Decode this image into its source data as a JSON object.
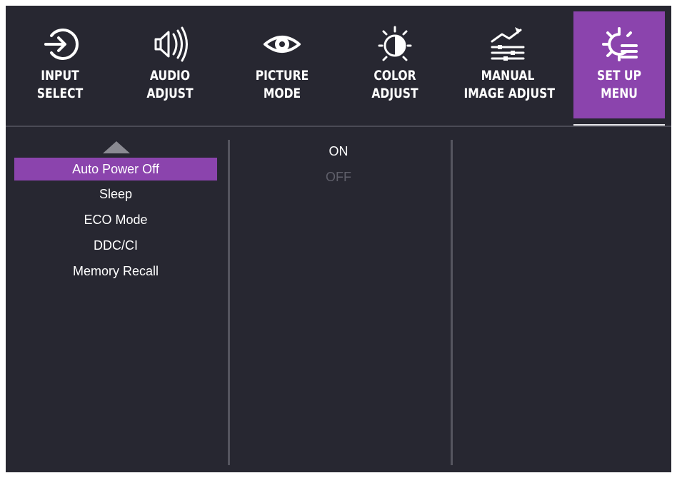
{
  "tabs": [
    {
      "line1": "INPUT",
      "line2": "SELECT",
      "icon": "input-select-icon"
    },
    {
      "line1": "AUDIO",
      "line2": "ADJUST",
      "icon": "audio-adjust-icon"
    },
    {
      "line1": "PICTURE",
      "line2": "MODE",
      "icon": "picture-mode-icon"
    },
    {
      "line1": "COLOR",
      "line2": "ADJUST",
      "icon": "color-adjust-icon"
    },
    {
      "line1": "MANUAL",
      "line2": "IMAGE ADJUST",
      "icon": "manual-image-adjust-icon"
    },
    {
      "line1": "SET UP",
      "line2": "MENU",
      "icon": "setup-menu-icon",
      "active": true
    }
  ],
  "menu": {
    "items": [
      "Auto Power Off",
      "Sleep",
      "ECO Mode",
      "DDC/CI",
      "Memory Recall"
    ],
    "selected": "Auto Power Off"
  },
  "options": {
    "items": [
      "ON",
      "OFF"
    ],
    "selected": "ON"
  },
  "colors": {
    "background": "#272731",
    "accent": "#8b44ad",
    "text": "#ffffff",
    "disabled_text": "#5f5f6a"
  }
}
